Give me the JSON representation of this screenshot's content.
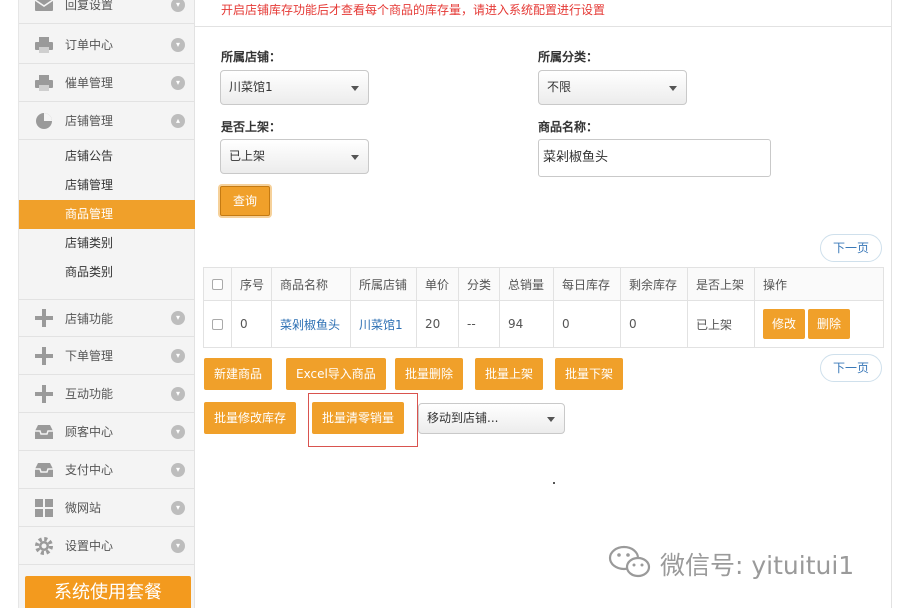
{
  "sidebar": {
    "items": [
      {
        "label": "回复设置",
        "icon": "mail-icon"
      },
      {
        "label": "订单中心",
        "icon": "printer-icon"
      },
      {
        "label": "催单管理",
        "icon": "printer-icon"
      },
      {
        "label": "店铺管理",
        "icon": "pie-chart-icon"
      }
    ],
    "sub_items": [
      {
        "label": "店铺公告",
        "active": false
      },
      {
        "label": "店铺管理",
        "active": false
      },
      {
        "label": "商品管理",
        "active": true
      },
      {
        "label": "店铺类别",
        "active": false
      },
      {
        "label": "商品类别",
        "active": false
      }
    ],
    "items2": [
      {
        "label": "店铺功能",
        "icon": "plus-icon"
      },
      {
        "label": "下单管理",
        "icon": "plus-icon"
      },
      {
        "label": "互动功能",
        "icon": "plus-icon"
      },
      {
        "label": "顾客中心",
        "icon": "inbox-icon"
      },
      {
        "label": "支付中心",
        "icon": "inbox-icon"
      },
      {
        "label": "微网站",
        "icon": "grid-icon"
      },
      {
        "label": "设置中心",
        "icon": "gear-icon"
      }
    ],
    "package_button": "系统使用套餐"
  },
  "notice": "开启店铺库存功能后才查看每个商品的库存量，请进入系统配置进行设置",
  "filters": {
    "store_label": "所属店铺：",
    "store_value": "川菜馆1",
    "category_label": "所属分类：",
    "category_value": "不限",
    "listed_label": "是否上架：",
    "listed_value": "已上架",
    "name_label": "商品名称：",
    "name_value": "菜剁椒鱼头",
    "query_button": "查询"
  },
  "pagination": {
    "next_label": "下一页"
  },
  "table": {
    "headers": [
      "序号",
      "商品名称",
      "所属店铺",
      "单价",
      "分类",
      "总销量",
      "每日库存",
      "剩余库存",
      "是否上架",
      "操作"
    ],
    "rows": [
      {
        "index": "0",
        "name": "菜剁椒鱼头",
        "store": "川菜馆1",
        "price": "20",
        "category": "--",
        "total_sales": "94",
        "daily_stock": "0",
        "remaining_stock": "0",
        "listed": "已上架",
        "edit": "修改",
        "delete": "删除"
      }
    ]
  },
  "actions": {
    "new_product": "新建商品",
    "excel_import": "Excel导入商品",
    "batch_delete": "批量删除",
    "batch_list": "批量上架",
    "batch_delist": "批量下架",
    "batch_edit_stock": "批量修改库存",
    "batch_clear_sales": "批量清零销量",
    "move_to_store": "移动到店铺..."
  },
  "watermark": "微信号: yituitui1",
  "colors": {
    "accent": "#f0a02a",
    "notice": "#e53935",
    "link": "#2c6fb3"
  }
}
